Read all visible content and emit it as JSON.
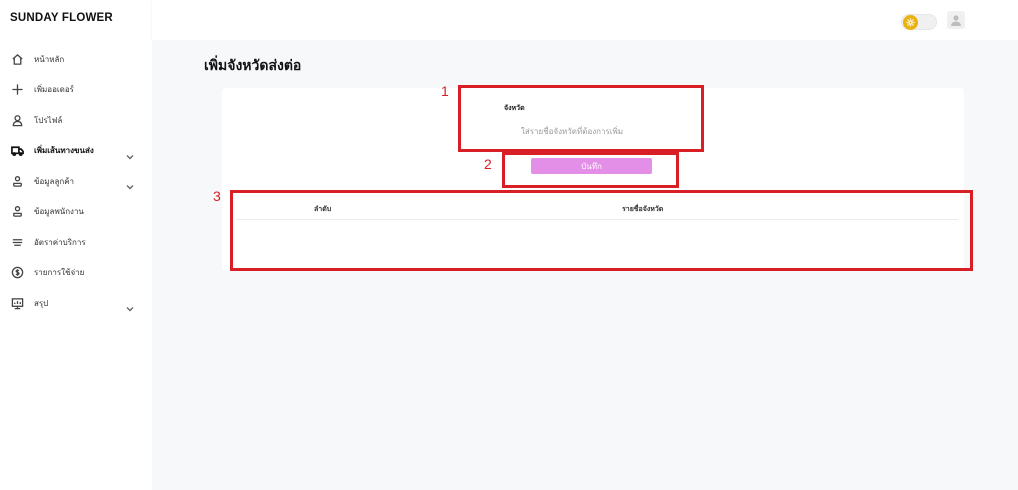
{
  "app": {
    "brand": "SUNDAY FLOWER"
  },
  "sidebar": {
    "items": [
      {
        "label": "หน้าหลัก",
        "icon": "home-icon",
        "expandable": false,
        "bold": false
      },
      {
        "label": "เพิ่มออเดอร์",
        "icon": "plus-icon",
        "expandable": false,
        "bold": false
      },
      {
        "label": "โปรไฟล์",
        "icon": "user-icon",
        "expandable": false,
        "bold": false
      },
      {
        "label": "เพิ่มเส้นทางขนส่ง",
        "icon": "truck-icon",
        "expandable": true,
        "bold": true
      },
      {
        "label": "ข้อมูลลูกค้า",
        "icon": "users-icon",
        "expandable": true,
        "bold": false
      },
      {
        "label": "ข้อมูลพนักงาน",
        "icon": "users-icon",
        "expandable": false,
        "bold": false
      },
      {
        "label": "อัตราค่าบริการ",
        "icon": "list-icon",
        "expandable": false,
        "bold": false
      },
      {
        "label": "รายการใช้จ่าย",
        "icon": "dollar-icon",
        "expandable": false,
        "bold": false
      },
      {
        "label": "สรุป",
        "icon": "report-icon",
        "expandable": true,
        "bold": false
      }
    ]
  },
  "topbar": {
    "theme_icon": "sun-icon",
    "theme_color": "#e9b20e",
    "avatar_icon": "user-avatar-icon"
  },
  "page": {
    "title": "เพิ่มจังหวัดส่งต่อ",
    "form": {
      "field_label": "จังหวัด",
      "field_placeholder": "ใส่รายชื่อจังหวัดที่ต้องการเพิ่ม",
      "field_value": "",
      "save_label": "บันทึก",
      "save_color": "#e38ee7"
    },
    "table": {
      "columns": [
        "ลำดับ",
        "รายชื่อจังหวัด"
      ],
      "rows": []
    }
  },
  "annotations": {
    "color": "#d81f26",
    "labels": [
      "1",
      "2",
      "3"
    ]
  }
}
